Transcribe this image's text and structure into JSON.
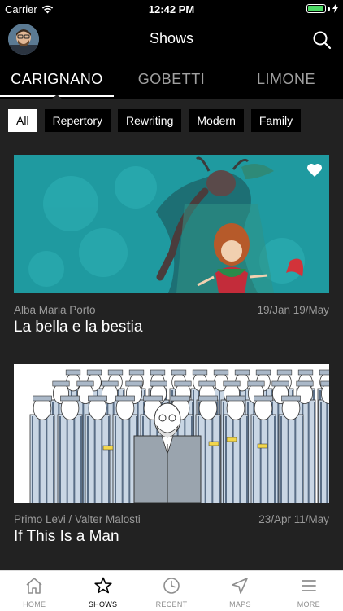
{
  "status": {
    "carrier": "Carrier",
    "time": "12:42 PM",
    "battery_level": 0.95
  },
  "header": {
    "title": "Shows"
  },
  "tabs": [
    {
      "label": "CARIGNANO",
      "active": true
    },
    {
      "label": "GOBETTI",
      "active": false
    },
    {
      "label": "LIMONE",
      "active": false
    }
  ],
  "filters": [
    {
      "label": "All",
      "active": true
    },
    {
      "label": "Repertory",
      "active": false
    },
    {
      "label": "Rewriting",
      "active": false
    },
    {
      "label": "Modern",
      "active": false
    },
    {
      "label": "Family",
      "active": false
    }
  ],
  "shows": [
    {
      "author": "Alba Maria Porto",
      "dates": "19/Jan 19/May",
      "title": "La bella e la bestia",
      "favorite": true
    },
    {
      "author": "Primo Levi / Valter Malosti",
      "dates": "23/Apr 11/May",
      "title": "If This Is a Man",
      "favorite": false
    }
  ],
  "bottom_nav": [
    {
      "label": "HOME",
      "icon": "home-icon",
      "active": false
    },
    {
      "label": "SHOWS",
      "icon": "star-icon",
      "active": true
    },
    {
      "label": "RECENT",
      "icon": "clock-icon",
      "active": false
    },
    {
      "label": "MAPS",
      "icon": "navigation-arrow-icon",
      "active": false
    },
    {
      "label": "MORE",
      "icon": "menu-icon",
      "active": false
    }
  ],
  "colors": {
    "background": "#222222",
    "header": "#000000",
    "battery": "#4cd964",
    "art1": "#1f9aa0"
  }
}
